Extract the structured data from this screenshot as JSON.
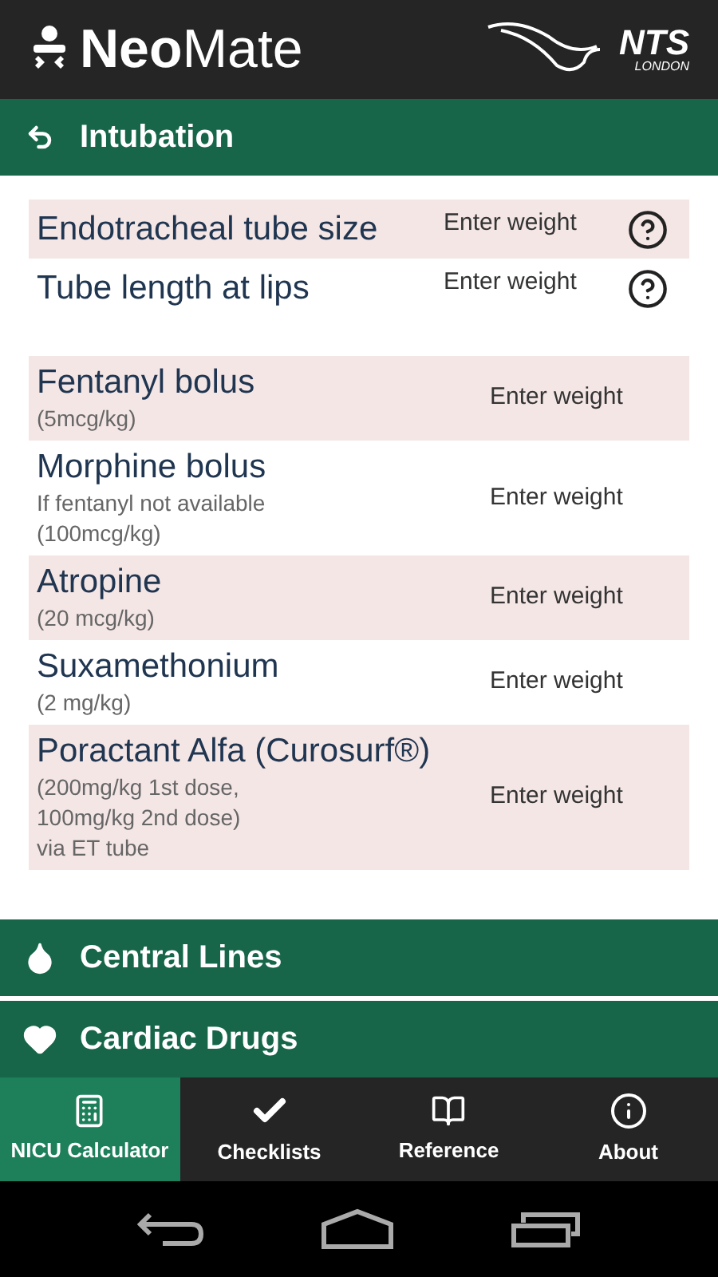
{
  "app_bar": {
    "title": "**Neo**Mate",
    "partner": "NTS",
    "partner_sub": "LONDON"
  },
  "sections": [
    {
      "title": "Intubation",
      "groups": [
        [
          {
            "name": "Endotracheal tube size",
            "result": "Enter weight",
            "help": true,
            "shaded": true
          },
          {
            "name": "Tube length at lips",
            "result": "Enter weight",
            "help": true,
            "shaded": false
          }
        ],
        [
          {
            "name": "Fentanyl bolus",
            "notes": [
              "(5mcg/kg)"
            ],
            "result": "Enter weight",
            "shaded": true
          },
          {
            "name": "Morphine bolus",
            "notes": [
              "If fentanyl not available",
              "(100mcg/kg)"
            ],
            "result": "Enter weight",
            "shaded": false
          },
          {
            "name": "Atropine",
            "notes": [
              "(20 mcg/kg)"
            ],
            "result": "Enter weight",
            "shaded": true
          },
          {
            "name": "Suxamethonium",
            "notes": [
              "(2 mg/kg)"
            ],
            "result": "Enter weight",
            "shaded": false
          },
          {
            "name": "Poractant Alfa (Curosurf®)",
            "notes": [
              "(200mg/kg 1st dose,",
              "100mg/kg 2nd dose)",
              "via ET tube"
            ],
            "result": "Enter weight",
            "shaded": true
          }
        ]
      ]
    },
    {
      "title": "Central Lines"
    },
    {
      "title": "Cardiac Drugs"
    }
  ],
  "tabs": [
    {
      "label": "NICU Calculator",
      "selected": true
    },
    {
      "label": "Checklists",
      "selected": false
    },
    {
      "label": "Reference",
      "selected": false
    },
    {
      "label": "About",
      "selected": false
    }
  ]
}
